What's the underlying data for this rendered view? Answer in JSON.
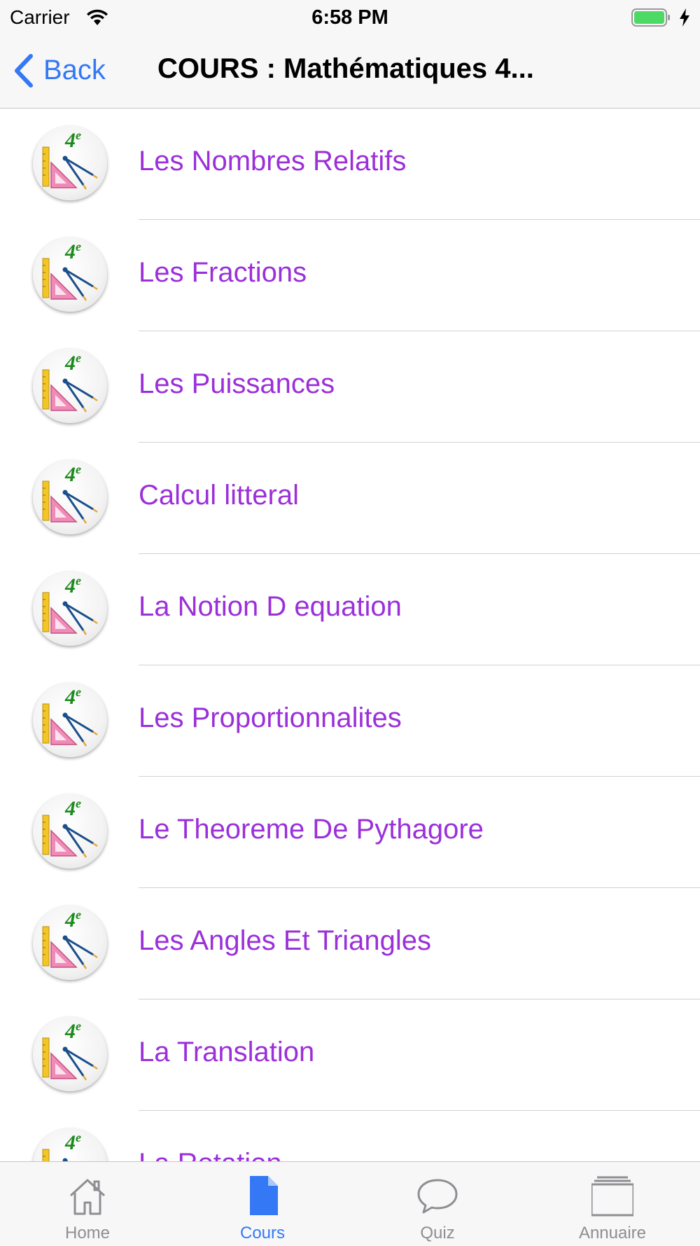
{
  "status_bar": {
    "carrier": "Carrier",
    "time": "6:58 PM"
  },
  "nav": {
    "back_label": "Back",
    "title": "COURS : Mathématiques 4..."
  },
  "thumbnail_badge": "4e",
  "courses": [
    {
      "label": "Les Nombres Relatifs"
    },
    {
      "label": "Les Fractions"
    },
    {
      "label": "Les Puissances"
    },
    {
      "label": "Calcul litteral"
    },
    {
      "label": "La Notion D equation"
    },
    {
      "label": "Les Proportionnalites"
    },
    {
      "label": "Le Theoreme De Pythagore"
    },
    {
      "label": "Les Angles Et Triangles"
    },
    {
      "label": "La Translation"
    },
    {
      "label": "La Rotation"
    }
  ],
  "tabs": [
    {
      "label": "Home",
      "icon": "house-icon",
      "active": false
    },
    {
      "label": "Cours",
      "icon": "document-icon",
      "active": true
    },
    {
      "label": "Quiz",
      "icon": "speech-bubble-icon",
      "active": false
    },
    {
      "label": "Annuaire",
      "icon": "tray-stack-icon",
      "active": false
    }
  ],
  "colors": {
    "accent": "#3478f6",
    "course_text": "#9b30d9",
    "inactive_tab": "#8e8e93"
  }
}
